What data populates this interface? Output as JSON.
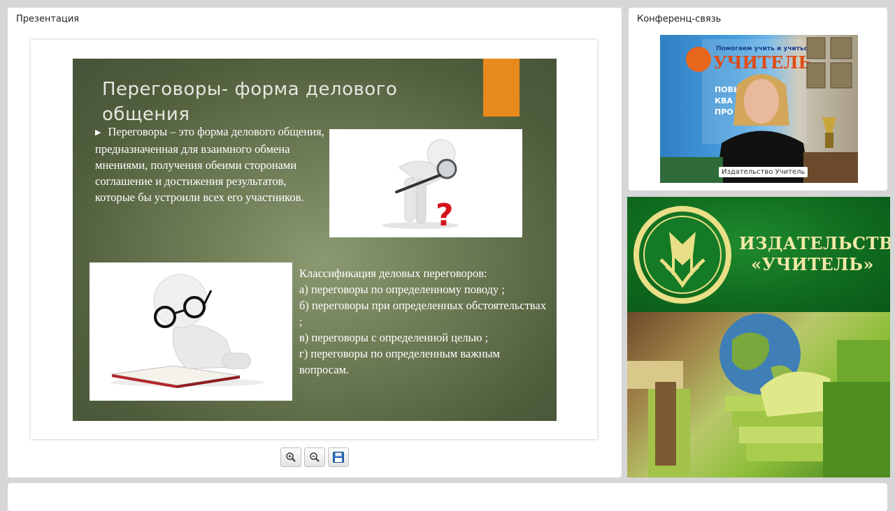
{
  "presentation_panel": {
    "title": "Презентация"
  },
  "conference_panel": {
    "title": "Конференц-связь",
    "video_caption": "Издательство Учитель"
  },
  "slide": {
    "title": "Переговоры- форма делового общения",
    "bullet_symbol": "▶",
    "paragraph1": "Переговоры – это форма делового общения, предназначенная для взаимного обмена мнениями, получения обеими сторонами соглашение и достижения результатов, которые бы устроили всех его участников.",
    "classification_title": "Классификация деловых переговоров:",
    "classification_items": [
      "а) переговоры по определенному поводу ;",
      "б) переговоры при определенных обстоятельствах ;",
      "в) переговоры с определенной целью ;",
      "г) переговоры по определенным важным вопросам."
    ],
    "accent_color": "#e8891c"
  },
  "toolbar": {
    "zoom_in": "zoom-in-icon",
    "zoom_out": "zoom-out-icon",
    "save": "save-icon"
  },
  "logo": {
    "line1": "ИЗДАТЕЛЬСТВО",
    "line2": "«УЧИТЕЛЬ»"
  },
  "video_banner": {
    "line1": "Помогаем учить и учиться",
    "brand": "УЧИТЕЛЬ",
    "fragments": [
      "ПОВЫ",
      "КВА",
      "ПРО"
    ]
  }
}
